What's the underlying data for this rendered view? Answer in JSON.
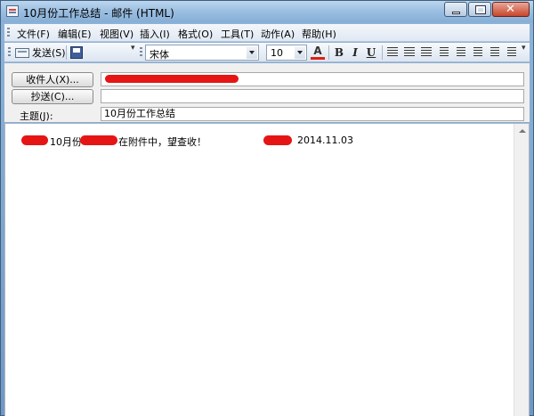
{
  "window": {
    "title": "10月份工作总结 - 邮件 (HTML)"
  },
  "menu": {
    "items": [
      "文件(F)",
      "编辑(E)",
      "视图(V)",
      "插入(I)",
      "格式(O)",
      "工具(T)",
      "动作(A)",
      "帮助(H)"
    ]
  },
  "toolbar": {
    "send_label": "发送(S)",
    "font_name": "宋体",
    "font_size": "10",
    "bold": "B",
    "italic": "I",
    "underline": "U",
    "font_color_glyph": "A",
    "font_color": "#d21a1a"
  },
  "header": {
    "to_button": "收件人(X)...",
    "cc_button": "抄送(C)...",
    "subject_label": "主题(J):",
    "subject_value": "10月份工作总结"
  },
  "body": {
    "prefix": "10月份",
    "middle": "在附件中，望查收！",
    "date": "2014.11.03"
  },
  "colors": {
    "redaction": "#e61515",
    "titlebar": "#9dc0e2"
  }
}
